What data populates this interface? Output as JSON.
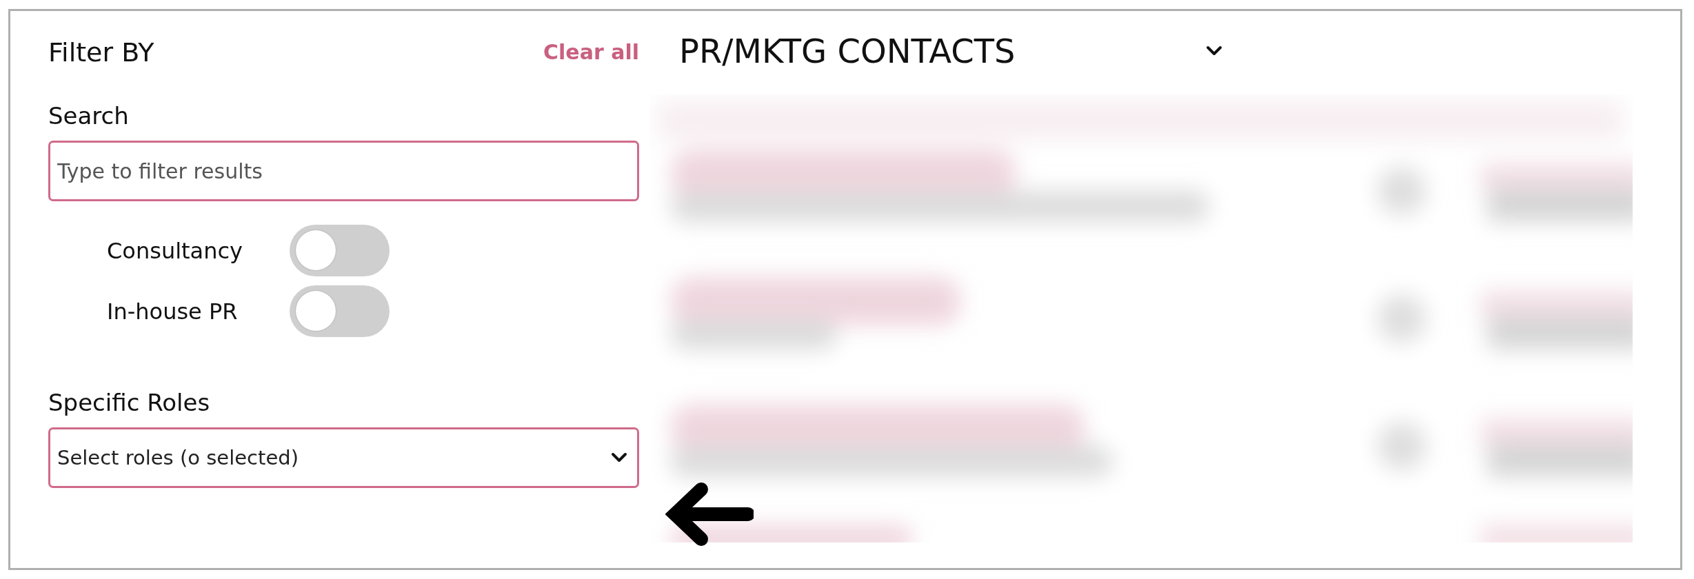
{
  "filter_panel": {
    "title": "Filter BY",
    "clear_link": "Clear all",
    "search": {
      "label": "Search",
      "placeholder": "Type to filter results"
    },
    "toggles": [
      {
        "label": "Consultancy",
        "on": false
      },
      {
        "label": "In-house PR",
        "on": false
      }
    ],
    "roles": {
      "label": "Specific Roles",
      "value": "Select roles (o selected)"
    }
  },
  "list_panel": {
    "title": "PR/MKTG CONTACTS"
  }
}
